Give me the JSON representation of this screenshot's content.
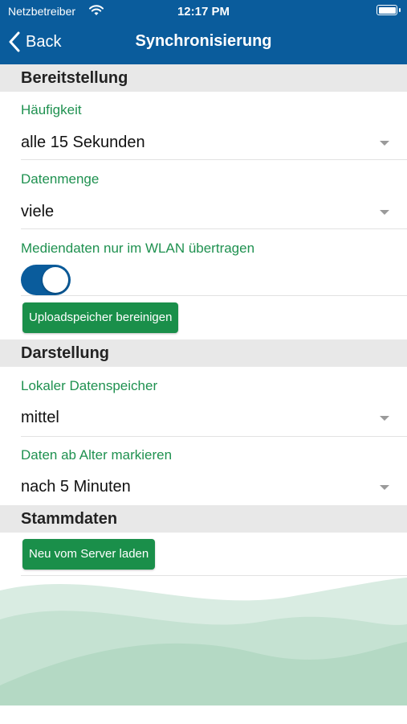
{
  "status_bar": {
    "carrier": "Netzbetreiber",
    "time": "12:17 PM"
  },
  "nav": {
    "back_label": "Back",
    "title": "Synchronisierung"
  },
  "sections": {
    "bereitstellung": {
      "title": "Bereitstellung",
      "haeufigkeit": {
        "label": "Häufigkeit",
        "value": "alle 15 Sekunden"
      },
      "datenmenge": {
        "label": "Datenmenge",
        "value": "viele"
      },
      "wlan": {
        "label": "Mediendaten nur im WLAN übertragen",
        "enabled": true
      },
      "clear_button": "Uploadspeicher bereinigen"
    },
    "darstellung": {
      "title": "Darstellung",
      "datenspeicher": {
        "label": "Lokaler Datenspeicher",
        "value": "mittel"
      },
      "alter": {
        "label": "Daten ab Alter markieren",
        "value": "nach 5 Minuten"
      }
    },
    "stammdaten": {
      "title": "Stammdaten",
      "reload_button": "Neu vom Server laden"
    }
  },
  "colors": {
    "nav_bg": "#0a5c9c",
    "accent_green": "#1a8f4a",
    "label_green": "#1f9150",
    "section_bg": "#e8e8e8"
  }
}
